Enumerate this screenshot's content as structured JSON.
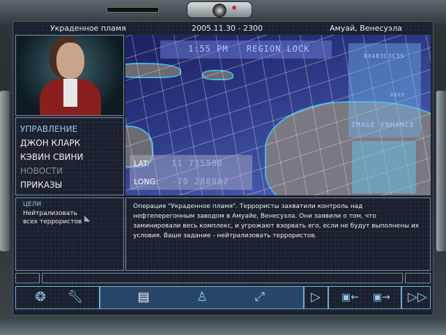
{
  "header": {
    "mission": "Украденное пламя",
    "datetime": "2005.11.30 - 2300",
    "location": "Амуай, Венесуэла"
  },
  "menu": [
    {
      "label": "УПРАВЛЕНИЕ",
      "state": "active"
    },
    {
      "label": "ДЖОН КЛАРК",
      "state": "normal"
    },
    {
      "label": "КЭВИН СВИНИ",
      "state": "normal"
    },
    {
      "label": "НОВОСТИ",
      "state": "disabled"
    },
    {
      "label": "ПРИКАЗЫ",
      "state": "normal"
    }
  ],
  "map": {
    "time": "1:55 PM",
    "region_lock": "REGION LOCK",
    "code": "0X4B3C3C35",
    "code2": "0859",
    "image_enhance": "IMAGE ENHANCE",
    "lat_label": "LAT:",
    "lat_value": "11 735580",
    "long_label": "LONG:",
    "long_value": "-70 288882"
  },
  "objectives": {
    "title": "ЦЕЛИ",
    "text": "Нейтрализовать всех террористов"
  },
  "briefing": "Операция \"Украденное пламя\". Террористы захватили контроль над нефтеперегонным заводом в Амуайе, Венесуэла. Они заявили о том, что заминировали весь комплекс, и угрожают взорвать его, если не будут выполнены их условия. Ваше задание - нейтрализовать террористов.",
  "toolbar": [
    "rainbow-logo-icon",
    "wrench-icon",
    "briefing-icon",
    "operative-icon",
    "plan-icon",
    "play-icon",
    "load-plan-icon",
    "save-plan-icon",
    "go-icon"
  ],
  "colors": {
    "accent": "#8fd0f0",
    "active_menu": "#9ac8e8",
    "disabled": "#8a8f96"
  }
}
